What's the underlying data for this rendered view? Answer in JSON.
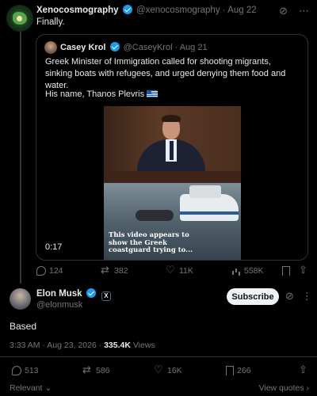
{
  "post": {
    "author_name": "Xenocosmography",
    "handle": "@xenocosmography",
    "date": "· Aug 22",
    "text": "Finally."
  },
  "quote": {
    "author_name": "Casey Krol",
    "handle": "@CaseyKrol",
    "date": "· Aug 21",
    "text": "Greek Minister of Immigration called for shooting migrants, sinking boats with refugees, and urged denying them food and water.",
    "text2": "His name, Thanos Plevris",
    "video_caption": "This video appears to show the Greek coastguard trying to...",
    "video_duration": "0:17"
  },
  "post_actions": {
    "replies": "124",
    "retweets": "382",
    "likes": "11K",
    "views": "558K"
  },
  "reply": {
    "author_name": "Elon Musk",
    "handle": "@elonmusk",
    "x_badge": "X",
    "subscribe_label": "Subscribe",
    "text": "Based",
    "timestamp": "3:33 AM · Aug 23, 2026 · ",
    "views_count": "335.4K",
    "views_label": " Views"
  },
  "reply_actions": {
    "replies": "513",
    "retweets": "586",
    "likes": "16K",
    "bookmarks": "266"
  },
  "footer": {
    "relevant_label": "Relevant",
    "view_quotes_label": "View quotes"
  }
}
